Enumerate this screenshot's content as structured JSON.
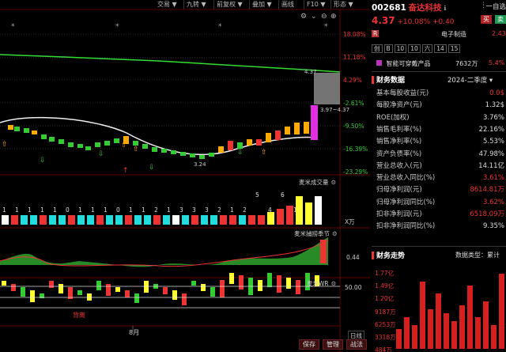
{
  "toolbar": {
    "items": [
      "交易",
      "九转",
      "前复权",
      "叠加",
      "画线",
      "F10",
      "形态"
    ],
    "arrows": [
      "▼",
      "▼",
      "▼",
      "▼",
      "",
      "▼",
      "▼"
    ]
  },
  "price_axis": [
    "18.08%",
    "11.18%",
    "4.29%",
    "-2.61%",
    "-9.50%",
    "-16.39%",
    "-23.29%"
  ],
  "ma_labels": {
    "top": "4.37",
    "range": "3.97~4.37",
    "low": "3.24"
  },
  "panels": {
    "volume": {
      "title": "麦米成交量",
      "unit": "X万"
    },
    "indicator": {
      "title": "麦米捕捞季节",
      "value": "0.44"
    },
    "wr": {
      "title": "麦米WR",
      "value": "50.00"
    }
  },
  "volume_counts": [
    "1",
    "1",
    "1",
    "1",
    "1",
    "0",
    "1",
    "1",
    "1",
    "0",
    "1",
    "1",
    "2",
    "1",
    "3",
    "3",
    "3",
    "2",
    "1",
    "2",
    "5",
    "4",
    "6",
    "1"
  ],
  "labels": {
    "month": "8月",
    "top_tag": "顶",
    "bottom_tag": "底",
    "buy_tag": "背离",
    "daily": "日线"
  },
  "bottom_buttons": [
    "保存",
    "管理",
    "战法"
  ],
  "quote": {
    "code": "002681",
    "name": "奋达科技",
    "info_icon": "ℹ",
    "price": "4.37",
    "change_pct": "+10.08%",
    "change": "+0.40",
    "buy": "买",
    "sell": "卖",
    "r_badge": "R",
    "sector": "电子制造",
    "sector_pct": "2.43",
    "tags": [
      "创",
      "B",
      "10",
      "10",
      "六",
      "14",
      "15"
    ],
    "concept": "智能可穿戴产品",
    "concept_vol": "7632万",
    "concept_pct": "5.4%",
    "top_right": "一自选"
  },
  "finance": {
    "title": "财务数据",
    "period": "2024-二季度",
    "rows": [
      {
        "label": "基本每股收益(元)",
        "value": "0.0$",
        "color": "red"
      },
      {
        "label": "每股净资产(元)",
        "value": "1.32$",
        "color": "wht"
      },
      {
        "label": "ROE(加权)",
        "value": "3.76%",
        "color": "wht"
      },
      {
        "label": "销售毛利率(%)",
        "value": "22.16%",
        "color": "wht"
      },
      {
        "label": "销售净利率(%)",
        "value": "5.53%",
        "color": "wht"
      },
      {
        "label": "资产负债率(%)",
        "value": "47.98%",
        "color": "wht"
      },
      {
        "label": "营业总收入(元)",
        "value": "14.11亿",
        "color": "wht"
      },
      {
        "label": "营业总收入同比(%)",
        "value": "3.61%",
        "color": "red"
      },
      {
        "label": "归母净利润(元)",
        "value": "8614.81万",
        "color": "red"
      },
      {
        "label": "归母净利润同比(%)",
        "value": "3.62%",
        "color": "red"
      },
      {
        "label": "扣非净利润(元)",
        "value": "6518.09万",
        "color": "red"
      },
      {
        "label": "扣非净利润同比(%)",
        "value": "9.35%",
        "color": "wht"
      }
    ]
  },
  "trend": {
    "title": "财务走势",
    "type_label": "数据类型：累计",
    "axis": [
      "1.77亿",
      "1.49亿",
      "1.20亿",
      "9187万",
      "6253万",
      "3318万",
      "484万"
    ]
  },
  "chart_data": {
    "type": "bar",
    "title": "财务走势",
    "values": [
      0.25,
      0.4,
      0.3,
      0.85,
      0.5,
      0.7,
      0.45,
      0.35,
      0.55,
      0.8,
      0.4,
      0.6,
      0.3,
      0.95
    ]
  }
}
